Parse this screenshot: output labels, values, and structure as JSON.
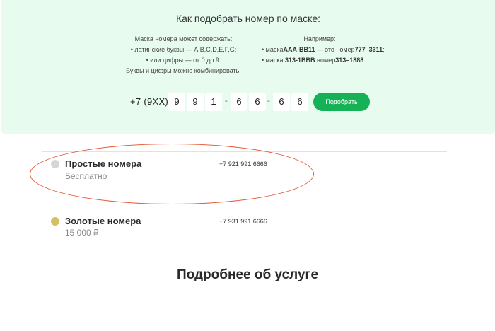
{
  "mask_panel": {
    "title": "Как подобрать номер по маске:",
    "left_column": {
      "heading": "Маска номера может содержать:",
      "items": [
        "латинские буквы — A,B,C,D,E,F,G;",
        "или цифры — от 0 до 9."
      ],
      "footer": "Буквы и цифры можно комбинировать."
    },
    "right_column": {
      "heading": "Например:",
      "items": [
        {
          "pre": "маска",
          "mask": "AAA-BB11",
          "mid": " — это номер",
          "number": "777–3311",
          "post": ";"
        },
        {
          "pre": "маска ",
          "mask": "313-1BBB",
          "mid": " номер",
          "number": "313–1888",
          "post": "."
        }
      ]
    },
    "prefix": "+7 (9XX)",
    "digits": [
      "9",
      "9",
      "1",
      "6",
      "6",
      "6",
      "6"
    ],
    "separator": "-",
    "pick_button": "Подобрать"
  },
  "rows": [
    {
      "name": "Простые номера",
      "price": "Бесплатно",
      "number": "+7 921 991 6666",
      "dot_color": "#d6d6d6"
    },
    {
      "name": "Золотые номера",
      "price": "15 000 ₽",
      "number": "+7 931 991 6666",
      "dot_color": "#d8bf5e"
    }
  ],
  "section_heading": "Подробнее об услуге",
  "colors": {
    "panel_bg": "#e7fbef",
    "accent_green": "#15b156",
    "annotation_red": "#e2532f"
  }
}
